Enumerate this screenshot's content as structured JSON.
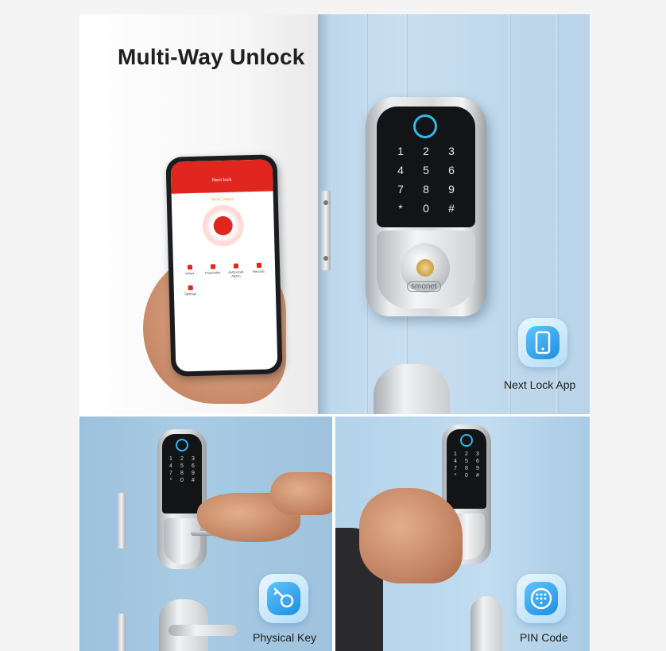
{
  "title": "Multi-Way Unlock",
  "lock": {
    "keypad_keys": [
      "1",
      "2",
      "3",
      "4",
      "5",
      "6",
      "7",
      "8",
      "9",
      "*",
      "0",
      "#"
    ],
    "brand": "smonet"
  },
  "app": {
    "header_title": "Next lock",
    "device_name": "M2001_30bbd1",
    "menu": [
      "eKeys",
      "Passcodes",
      "Authorized Admin",
      "Records",
      "Settings"
    ]
  },
  "features": [
    {
      "label": "Next Lock App",
      "icon": "phone-icon"
    },
    {
      "label": "Physical Key",
      "icon": "key-icon"
    },
    {
      "label": "PIN Code",
      "icon": "keypad-icon"
    }
  ],
  "colors": {
    "accent_blue": "#1e8ee0",
    "app_red": "#e0261e",
    "fingerprint_ring": "#36b7ea"
  }
}
